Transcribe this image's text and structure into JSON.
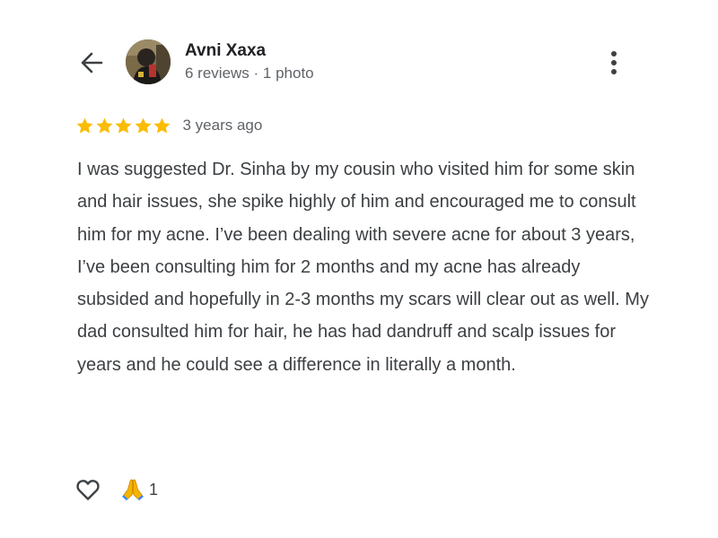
{
  "review": {
    "author_name": "Avni Xaxa",
    "author_meta": "6 reviews · 1 photo",
    "rating": 5,
    "rating_max": 5,
    "age": "3 years ago",
    "text": "I was suggested Dr. Sinha by my cousin who visited him for some skin and hair issues, she spike highly of him and encouraged me to consult him for my acne. I’ve been dealing with severe acne for about 3 years, I’ve been consulting him for 2 months and my acne has already subsided and hopefully in 2-3 months my scars will clear out as well. My dad consulted him for hair, he has had dandruff and scalp issues for years and he could see a difference in literally a month."
  },
  "reactions": {
    "count": "1"
  },
  "icons": {
    "back": "arrow-back-icon",
    "more": "more-vert-icon",
    "like": "heart-outline-icon",
    "reaction": "folded-hands-icon",
    "star": "star-icon"
  },
  "colors": {
    "star": "#FBBC04",
    "text_primary": "#202124",
    "text_secondary": "#5f6368",
    "body_text": "#3c4043"
  }
}
